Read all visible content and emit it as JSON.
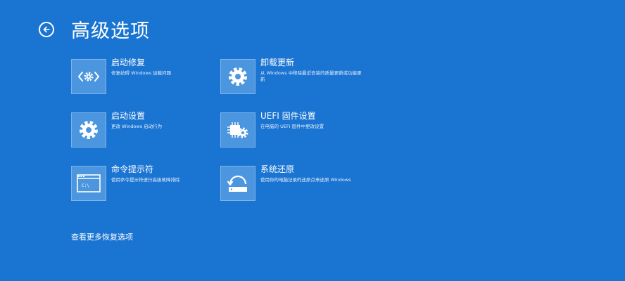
{
  "header": {
    "title": "高级选项",
    "back_icon": "back-arrow-icon"
  },
  "tiles": [
    {
      "title": "启动修复",
      "desc": "修复妨碍 Windows 加载问题",
      "icon": "code-gear-icon"
    },
    {
      "title": "卸载更新",
      "desc": "从 Windows 中移除最近安装的质量更新或功能更新",
      "icon": "gear-icon"
    },
    {
      "title": "启动设置",
      "desc": "更改 Windows 启动行为",
      "icon": "gear-icon"
    },
    {
      "title": "UEFI 固件设置",
      "desc": "在电脑的 UEFI 固件中更改设置",
      "icon": "chip-gear-icon"
    },
    {
      "title": "命令提示符",
      "desc": "使用命令提示符进行高级故障排除",
      "icon": "command-prompt-icon"
    },
    {
      "title": "系统还原",
      "desc": "使用你的电脑记录的还原点来还原 Windows",
      "icon": "system-restore-icon"
    }
  ],
  "footer": {
    "more_link": "查看更多恢复选项"
  },
  "colors": {
    "background": "#1a74d2",
    "tile_bg": "#4c96e0",
    "text": "#ffffff"
  }
}
